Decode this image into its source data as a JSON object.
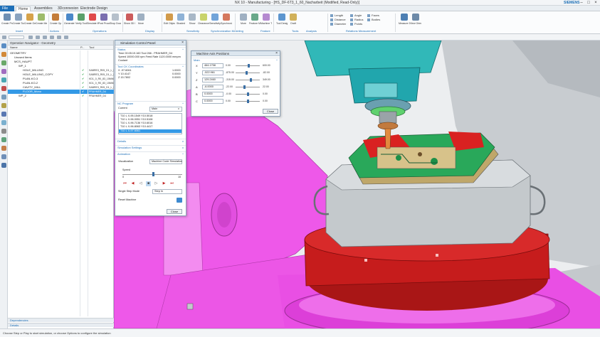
{
  "window": {
    "title": "NX 10 - Manufacturing - [HS_DF-6T3_1_60_Nacharbeit (Modified, Read-Only)]",
    "brand": "SIEMENS",
    "controls": [
      "–",
      "□",
      "×"
    ]
  },
  "tabs": [
    "File",
    "Home",
    "Assemblies",
    "3Dconnexion",
    "Electrode Design"
  ],
  "ribbon": {
    "buttons": [
      "Create Program",
      "Create Tool",
      "Create Geometry",
      "Create Method",
      "Create Operation",
      "Generate Tool Path",
      "Verify Tool Path",
      "Simulate Machine",
      "Post Process",
      "Shop Documentation",
      "Show 3D IPW",
      "More",
      "Edit Object",
      "Shaded",
      "Show",
      "Clearance",
      "Sensitivity",
      "Synchronization Manager",
      "More",
      "Feature Manager",
      "Machine Tool Builder",
      "Tool Design",
      "Draft",
      "Measure Distance",
      "View Orientation"
    ],
    "groups": [
      "Insert",
      "Actions",
      "Operations",
      "Display",
      "Sensitivity",
      "Synchronization Modeling",
      "Feature",
      "Tools",
      "Analysis",
      "Relations Measurement"
    ],
    "measure_items": [
      "Length",
      "Distance",
      "Diameter",
      "Angle",
      "Radius",
      "Points",
      "Faces",
      "Bodies"
    ]
  },
  "navigator": {
    "title": "Operation Navigator - Geometry",
    "columns": [
      "Name",
      "P...",
      "Tool"
    ],
    "rows": [
      {
        "name": "GEOMETRY",
        "tool": "",
        "indent": 0
      },
      {
        "name": "Unused Items",
        "tool": "",
        "indent": 1
      },
      {
        "name": "MCS_HAUPT",
        "tool": "",
        "indent": 1
      },
      {
        "name": "WP_1",
        "tool": "",
        "indent": 2
      },
      {
        "name": "HOLE_MILLING",
        "tool": "SABRE3_R05_D1_L_R05",
        "indent": 3
      },
      {
        "name": "HOLE_MILLING_COPY",
        "tool": "SABRE3_R05_D1_L_R05",
        "indent": 3
      },
      {
        "name": "PLAN-KO-3",
        "tool": "KD1_0_R0_83_15MM",
        "indent": 3
      },
      {
        "name": "PLAN-KO-2",
        "tool": "KD1_0_R0_83_15MM",
        "indent": 3
      },
      {
        "name": "CAVITY_MILL",
        "tool": "SABRE3_R05_D1_L_R05",
        "indent": 3
      },
      {
        "name": "FLOOR_Mono",
        "tool": "PRAHMER_D4",
        "indent": 3,
        "selected": true
      },
      {
        "name": "WP_2",
        "tool": "PRAHMER_D4",
        "indent": 2
      }
    ],
    "footer": [
      "Dependencies",
      "Details"
    ]
  },
  "status_bar": "Choose Step or Play to start simulation, or choose Options to configure the simulation",
  "sim_panel": {
    "title": "Simulation Control Panel",
    "sections": [
      "Status",
      "Tool CK Coordinates",
      "NC Program",
      "Details",
      "Simulation Settings",
      "Animation"
    ],
    "status_lines": [
      "Time 00:05:19.160    Tool 266 - PRAHMER_D4",
      "Speed 10000.000 rpm  Feed Rate 1120.0000 mmpm",
      "Coolant"
    ],
    "coords": [
      {
        "axis": "X -97.6061",
        "val": "1.0000"
      },
      {
        "axis": "Y 10.4147",
        "val": "0.0000"
      },
      {
        "axis": "Z 15.7802",
        "val": "0.0000"
      }
    ],
    "nc_current_label": "Current",
    "nc_current_value": "Main",
    "nc_lines": [
      "T10 L X-95.1549 Y10.5018",
      "T10 L X-96.0051 Y10.5108",
      "T10 L X-96.7136 Y10.6016",
      "T10 L X-96.8063 Y10.4417",
      "T10 L X-97.6061"
    ],
    "visualization_label": "Visualization",
    "visualization_value": "Machine Code Simulation",
    "speed_label": "Speed",
    "speed_min": "0",
    "speed_max": "10",
    "single_step_label": "Single Step Mode",
    "single_step_value": "Step In",
    "reset_label": "Reset Machine",
    "close": "Close"
  },
  "axis_panel": {
    "title": "Machine Axis Positions",
    "section": "Main",
    "close": "Close",
    "axes": [
      {
        "name": "X",
        "value": "464.1758",
        "min": "0.00",
        "max": "600.00",
        "pos": 0.54
      },
      {
        "name": "Y",
        "value": "-522.961",
        "min": "-875.00",
        "max": "-82.00",
        "pos": 0.45
      },
      {
        "name": "Z",
        "value": "129.2460",
        "min": "-315.00",
        "max": "349.00",
        "pos": 0.62
      },
      {
        "name": "A",
        "value": "-6.0000",
        "min": "-22.00",
        "max": "22.00",
        "pos": 0.36
      },
      {
        "name": "B",
        "value": "0.0000",
        "min": "-0.00",
        "max": "0.00",
        "pos": 0.5
      },
      {
        "name": "C",
        "value": "0.0000",
        "min": "0.00",
        "max": "0.00",
        "pos": 0.5
      }
    ]
  },
  "colors": {
    "accent": "#1d6fb8",
    "selection": "#3399e6",
    "machine_magenta": "#ee58e9",
    "table_red": "#c61c1c",
    "spindle_cyan": "#33c8c8",
    "fixture_gray": "#c4c9cc",
    "part_green": "#29a85a"
  }
}
